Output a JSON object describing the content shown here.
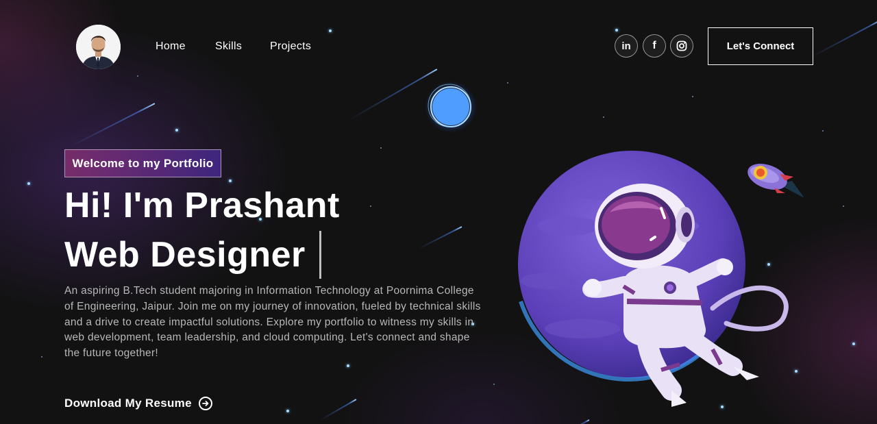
{
  "nav": {
    "avatar_alt": "Profile photo",
    "links": [
      {
        "label": "Home"
      },
      {
        "label": "Skills"
      },
      {
        "label": "Projects"
      }
    ],
    "social": [
      {
        "icon": "linkedin-icon",
        "glyph": "in"
      },
      {
        "icon": "facebook-icon",
        "glyph": "f"
      },
      {
        "icon": "instagram-icon",
        "glyph": ""
      }
    ],
    "connect_label": "Let's Connect"
  },
  "hero": {
    "tagline": "Welcome to my Portfolio",
    "greeting": "Hi! I'm Prashant",
    "role": "Web Designer",
    "description": "An aspiring B.Tech student majoring in Information Technology at Poornima College of Engineering, Jaipur. Join me on my journey of innovation, fueled by technical skills and a drive to create impactful solutions. Explore my portfolio to witness my skills in web development, team leadership, and cloud computing. Let's connect and shape the future together!",
    "download_label": "Download My Resume"
  },
  "colors": {
    "background": "#121212",
    "tagline_gradient_start": "#AA367C",
    "tagline_gradient_end": "#4A2FBD",
    "planet": "#6a48c8",
    "star": "#a8dcff"
  }
}
